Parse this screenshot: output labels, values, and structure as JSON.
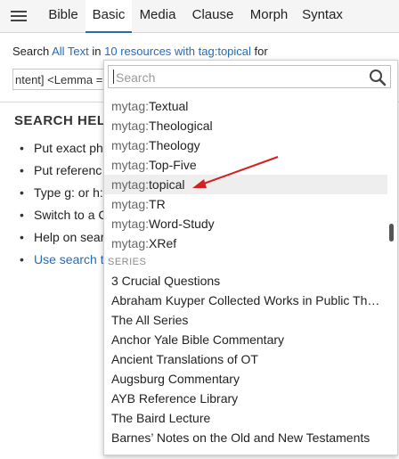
{
  "tabs": [
    "Bible",
    "Basic",
    "Media",
    "Clause",
    "Morph",
    "Syntax"
  ],
  "search_line": {
    "prefix": "Search",
    "scope_link": "All Text",
    "in_word": "in",
    "resources_link": "10 resources with tag:topical",
    "suffix": "for"
  },
  "query_value": "ntent] <Lemma = ",
  "help": {
    "title": "SEARCH HELP",
    "items": [
      "Put exact ph",
      "Put referenc",
      "Type g: or h:",
      "Switch to a C",
      "Help on sear",
      "Use search t"
    ]
  },
  "dropdown": {
    "search_placeholder": "Search",
    "tags": [
      {
        "prefix": "mytag:",
        "name": "Textual"
      },
      {
        "prefix": "mytag:",
        "name": "Theological"
      },
      {
        "prefix": "mytag:",
        "name": "Theology"
      },
      {
        "prefix": "mytag:",
        "name": "Top-Five"
      },
      {
        "prefix": "mytag:",
        "name": "topical"
      },
      {
        "prefix": "mytag:",
        "name": "TR"
      },
      {
        "prefix": "mytag:",
        "name": "Word-Study"
      },
      {
        "prefix": "mytag:",
        "name": "XRef"
      }
    ],
    "series_header": "SERIES",
    "series": [
      "3 Crucial Questions",
      "Abraham Kuyper Collected Works in Public Th…",
      "The All Series",
      "Anchor Yale Bible Commentary",
      "Ancient Translations of OT",
      "Augsburg Commentary",
      "AYB Reference Library",
      "The Baird Lecture",
      "Barnes’ Notes on the Old and New Testaments"
    ]
  },
  "colors": {
    "link": "#1f6bbf",
    "active_tab_underline": "#2a6ab0",
    "annotation_arrow": "#d32020"
  }
}
